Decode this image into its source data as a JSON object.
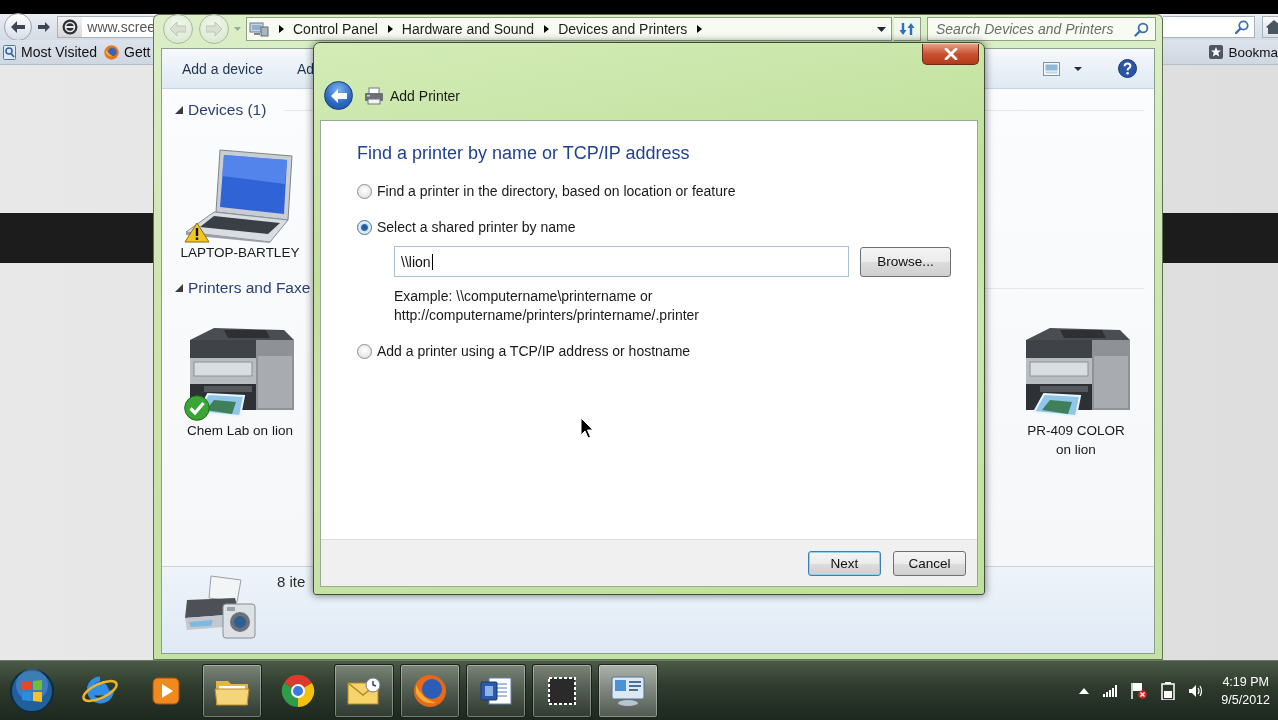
{
  "browser": {
    "address": {
      "value": "www.scree"
    },
    "bookmarks": [
      {
        "label": "Most Visited",
        "kind": "page"
      },
      {
        "label": "Gett",
        "kind": "globe"
      }
    ],
    "bookmarks_menu": {
      "label": "Bookma"
    }
  },
  "explorer": {
    "breadcrumb": [
      "Control Panel",
      "Hardware and Sound",
      "Devices and Printers"
    ],
    "search": {
      "placeholder": "Search Devices and Printers"
    },
    "toolbar": [
      "Add a device",
      "Ad"
    ],
    "groups": [
      {
        "title": "Devices (1)",
        "expanded": true,
        "items": [
          {
            "label": "LAPTOP-BARTLEY",
            "kind": "laptop",
            "warning": true,
            "default": false
          }
        ]
      },
      {
        "title": "Printers and Faxe",
        "expanded": true,
        "items": [
          {
            "label": "Chem Lab on lion",
            "kind": "printer",
            "warning": false,
            "default": true
          },
          {
            "label": "PR-409 COLOR on lion",
            "kind": "printer",
            "warning": false,
            "default": false
          }
        ]
      }
    ],
    "details": {
      "count": "8 ite"
    }
  },
  "dialog": {
    "title": "Add Printer",
    "heading": "Find a printer by name or TCP/IP address",
    "options": [
      {
        "label": "Find a printer in the directory, based on location or feature",
        "selected": false
      },
      {
        "label": "Select a shared printer by name",
        "selected": true
      },
      {
        "label": "Add a printer using a TCP/IP address or hostname",
        "selected": false
      }
    ],
    "printer_name": {
      "value": "\\\\lion"
    },
    "browse_button": "Browse...",
    "example": "Example: \\\\computername\\printername or http://computername/printers/printername/.printer",
    "buttons": [
      {
        "label": "Next",
        "default": true
      },
      {
        "label": "Cancel",
        "default": false
      }
    ]
  },
  "taskbar": {
    "apps": [
      {
        "kind": "internet-explorer",
        "running": false,
        "active": false
      },
      {
        "kind": "media-player",
        "running": false,
        "active": false
      },
      {
        "kind": "file-explorer",
        "running": true,
        "active": false
      },
      {
        "kind": "chrome",
        "running": false,
        "active": false
      },
      {
        "kind": "mail",
        "running": true,
        "active": false
      },
      {
        "kind": "firefox",
        "running": true,
        "active": false
      },
      {
        "kind": "word",
        "running": true,
        "active": false
      },
      {
        "kind": "snipping-tool",
        "running": true,
        "active": false
      },
      {
        "kind": "control-panel",
        "running": true,
        "active": true
      }
    ],
    "clock": {
      "time": "4:19 PM",
      "date": "9/5/2012"
    }
  }
}
